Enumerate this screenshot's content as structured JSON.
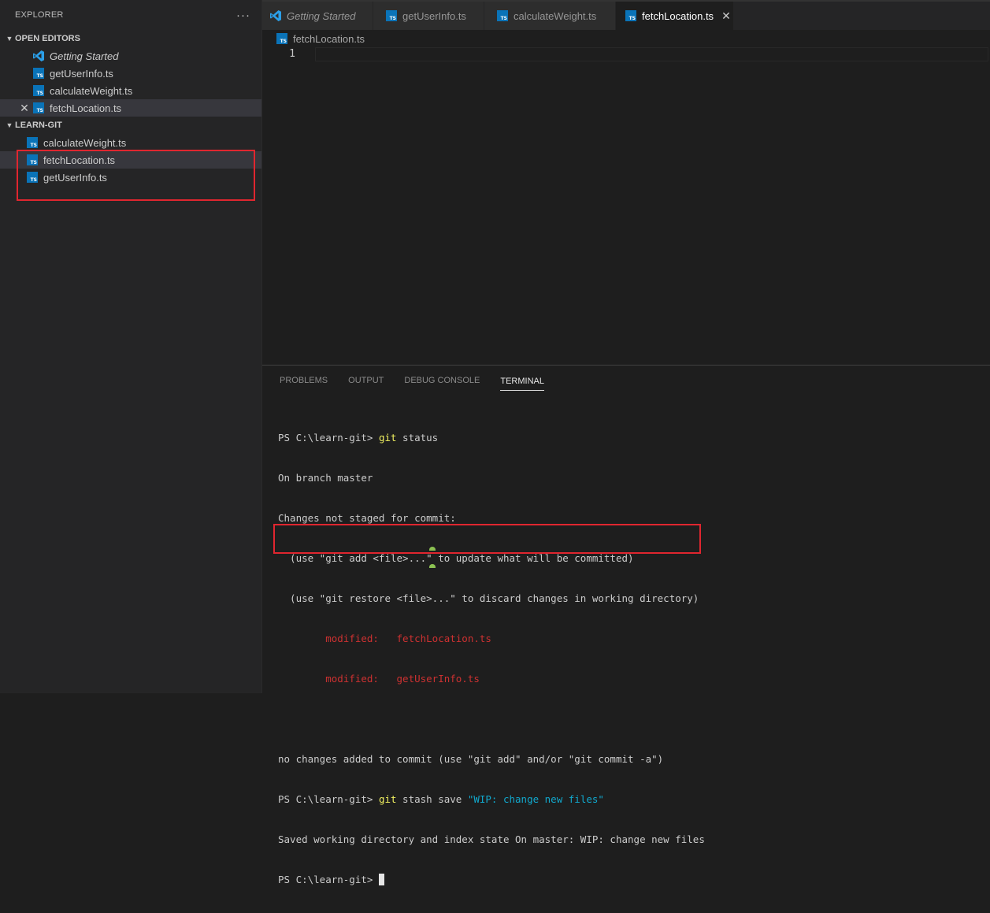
{
  "sidebar": {
    "header": "EXPLORER",
    "more": "···",
    "open_editors": {
      "title": "OPEN EDITORS",
      "items": [
        {
          "label": "Getting Started",
          "icon": "vscode-icon"
        },
        {
          "label": "getUserInfo.ts",
          "icon": "typescript-icon"
        },
        {
          "label": "calculateWeight.ts",
          "icon": "typescript-icon"
        },
        {
          "label": "fetchLocation.ts",
          "icon": "typescript-icon",
          "close": "✕"
        }
      ]
    },
    "folder": {
      "title": "LEARN-GIT",
      "items": [
        {
          "label": "calculateWeight.ts"
        },
        {
          "label": "fetchLocation.ts"
        },
        {
          "label": "getUserInfo.ts"
        }
      ]
    }
  },
  "tabs": [
    {
      "label": "Getting Started"
    },
    {
      "label": "getUserInfo.ts"
    },
    {
      "label": "calculateWeight.ts"
    },
    {
      "label": "fetchLocation.ts",
      "close": "✕"
    }
  ],
  "breadcrumb": "fetchLocation.ts",
  "editor": {
    "line_number": "1"
  },
  "panel": {
    "tabs": [
      "PROBLEMS",
      "OUTPUT",
      "DEBUG CONSOLE",
      "TERMINAL"
    ],
    "terminal": {
      "l1_prompt": "PS C:\\learn-git> ",
      "l1_cmd": "git",
      "l1_rest": " status",
      "l2": "On branch master",
      "l3": "Changes not staged for commit:",
      "l4": "  (use \"git add <file>...\" to update what will be committed)",
      "l5": "  (use \"git restore <file>...\" to discard changes in working directory)",
      "l6": "        modified:   fetchLocation.ts",
      "l7": "        modified:   getUserInfo.ts",
      "l8": "",
      "l9": "no changes added to commit (use \"git add\" and/or \"git commit -a\")",
      "l10_prompt": "PS C:\\learn-git> ",
      "l10_cmd": "git",
      "l10_rest": " stash save ",
      "l10_str": "\"WIP: change new files\"",
      "l11": "Saved working directory and index state On master: WIP: change new files",
      "l12_prompt": "PS C:\\learn-git> "
    }
  },
  "colors": {
    "accent_highlight": "#e0262f",
    "ts_icon": "#0a73b8",
    "terminal_yellow": "#f1f160",
    "terminal_red": "#cd3131",
    "terminal_cyan": "#11a8cd"
  }
}
